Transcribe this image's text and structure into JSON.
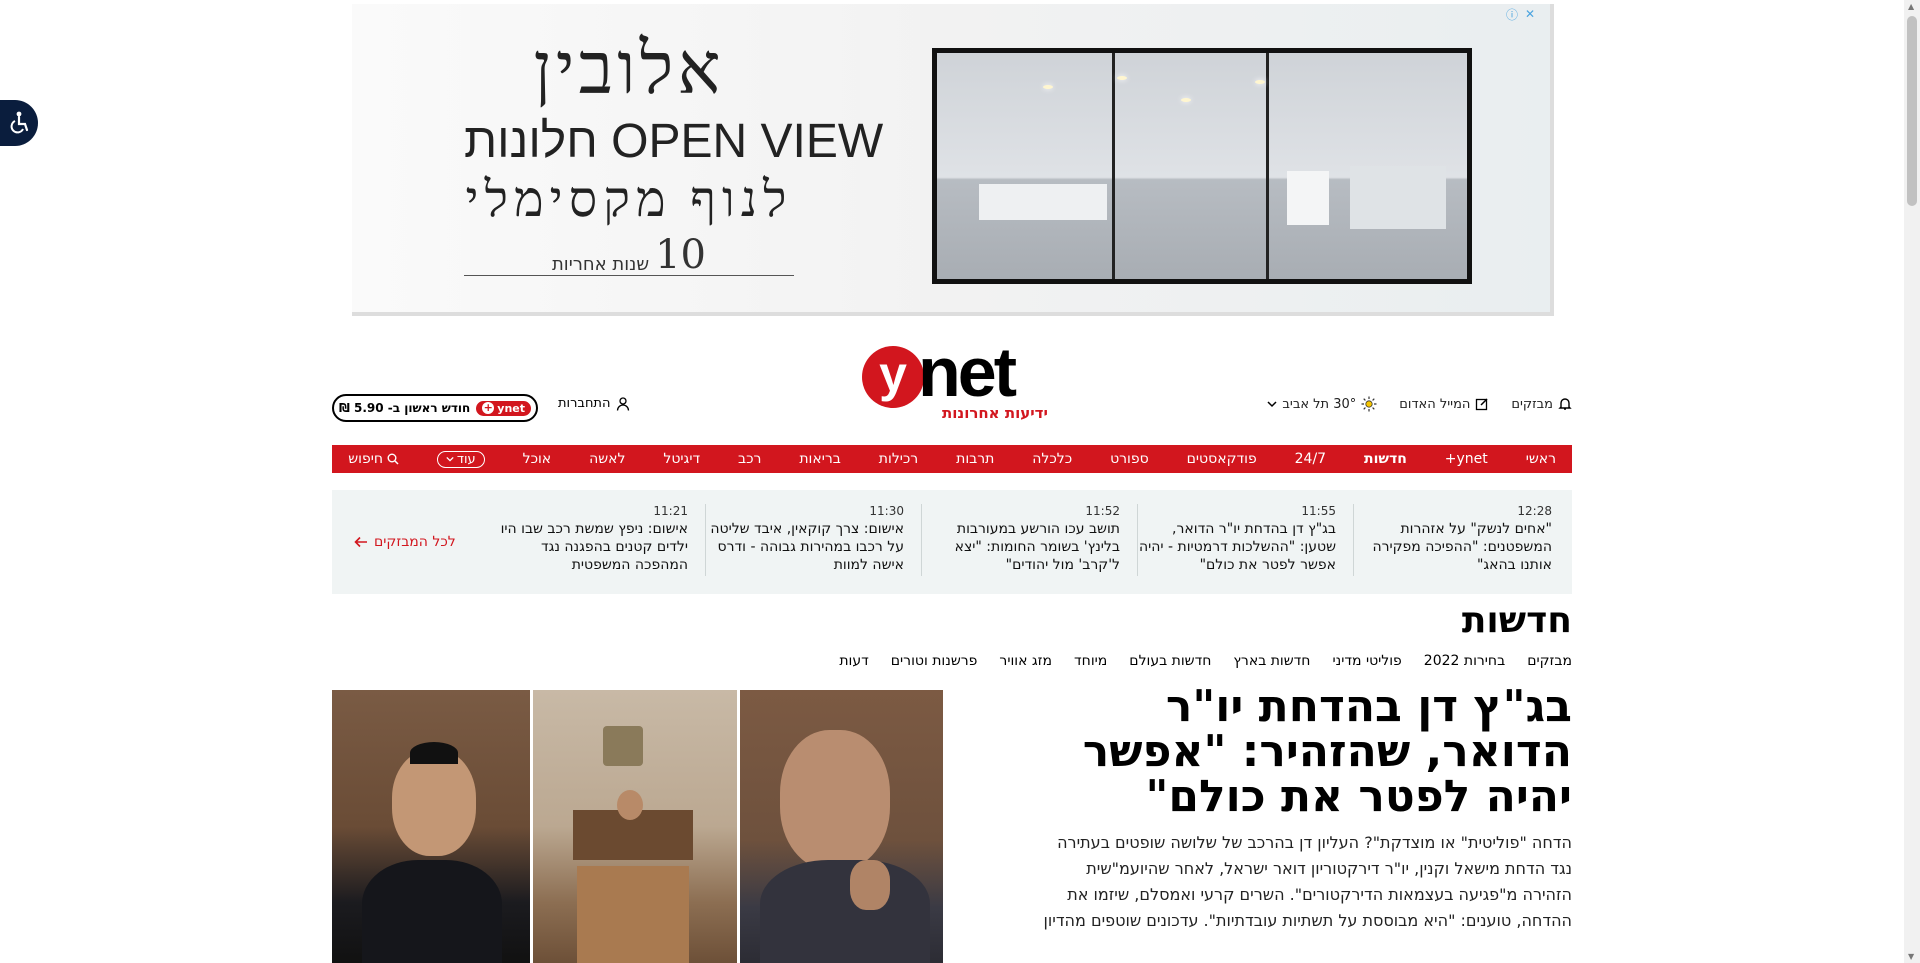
{
  "accessibility": {
    "icon": "wheelchair-icon"
  },
  "ad": {
    "brand": "אלובין",
    "line1": "חלונות OPEN VIEW",
    "line2": "לנוף מקסימלי",
    "warranty_number": "10",
    "warranty_text": "שנות אחריות",
    "info_icon": "ⓘ",
    "close_icon": "✕"
  },
  "header": {
    "logo": {
      "y": "y",
      "net": "net",
      "sub": "ידיעות אחרונות"
    },
    "utils": {
      "alerts": "מבזקים",
      "red_mail": "המייל האדום",
      "weather": "30° תל אביב"
    },
    "login": "התחברות",
    "subscribe": {
      "badge": "ynet",
      "text": "חודש ראשון ב- 5.90 ₪"
    }
  },
  "nav": {
    "items": [
      "ראשי",
      "ynet+",
      "חדשות",
      "24/7",
      "פודקאסטים",
      "ספורט",
      "כלכלה",
      "תרבות",
      "רכילות",
      "בריאות",
      "רכב",
      "דיגיטל",
      "לאשה",
      "אוכל"
    ],
    "active": "חדשות",
    "more": "עוד",
    "search": "חיפוש"
  },
  "breaking": {
    "items": [
      {
        "time": "12:28",
        "title": "\"אחים לנשק\" על אזהרות המשפטנים: \"ההפיכה מפקירה אותנו בהאג\""
      },
      {
        "time": "11:55",
        "title": "בג\"ץ דן בהדחת יו\"ר הדואר, שטען: \"ההשלכות דרמטיות - יהיה אפשר לפטר את כולם\""
      },
      {
        "time": "11:52",
        "title": "תושב עכו הורשע במעורבות בלינץ' בשומר החומות: \"יצא ל'קרב' מול יהודים\""
      },
      {
        "time": "11:30",
        "title": "אישום: צרך קוקאין, איבד שליטה על רכבו במהירות גבוהה - ודרס אישה למוות"
      },
      {
        "time": "11:21",
        "title": "אישום: ניפץ שמשת רכב שבו היו ילדים קטנים בהפגנה נגד המהפכה המשפטית"
      }
    ],
    "all_link": "לכל המבזקים"
  },
  "section": {
    "title": "חדשות",
    "subnav": [
      "מבזקים",
      "בחירות 2022",
      "פוליטי מדיני",
      "חדשות בארץ",
      "חדשות בעולם",
      "מיוחד",
      "מזג אוויר",
      "פרשנות וטורים",
      "דעות"
    ]
  },
  "lead": {
    "title": "בג\"ץ דן בהדחת יו\"ר הדואר, שהזהיר: \"אפשר יהיה לפטר את כולם\"",
    "description": "הדחה \"פוליטית\" או מוצדקת\"? העליון דן בהרכב של שלושה שופטים בעתירה נגד הדחת מישאל וקנין, יו\"ר דירקטוריון דואר ישראל, לאחר שהיועמ\"שית הזהירה מ\"פגיעה בעצמאות הדירקטורים\". השרים קרעי ואמסלם, שיזמו את ההדחה, טוענים: \"היא מבוססת על תשתיות עובדתיות\". עדכונים שוטפים מהדיון"
  },
  "colors": {
    "brand_red": "#d2161e",
    "strip_bg": "#f0f4f4"
  }
}
